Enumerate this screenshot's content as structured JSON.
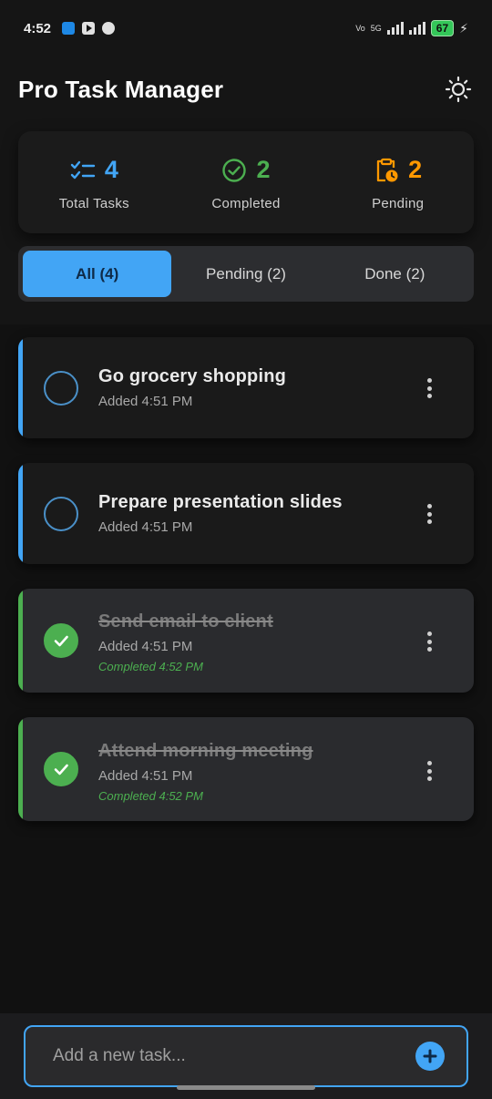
{
  "status_bar": {
    "time": "4:52",
    "network_label_1": "Vo",
    "network_label_2": "5G",
    "battery": "67",
    "icons": [
      "app-icon",
      "youtube-icon",
      "call-icon",
      "signal-icon",
      "battery-icon",
      "charging-icon"
    ]
  },
  "header": {
    "title": "Pro Task Manager",
    "theme_icon": "sun-icon"
  },
  "stats": [
    {
      "value": "4",
      "label": "Total Tasks",
      "icon": "checklist-icon",
      "color": "#42a5f5"
    },
    {
      "value": "2",
      "label": "Completed",
      "icon": "check-circle-icon",
      "color": "#4caf50"
    },
    {
      "value": "2",
      "label": "Pending",
      "icon": "clipboard-clock-icon",
      "color": "#ff9800"
    }
  ],
  "tabs": [
    {
      "label": "All (4)",
      "active": true
    },
    {
      "label": "Pending (2)",
      "active": false
    },
    {
      "label": "Done (2)",
      "active": false
    }
  ],
  "tasks": [
    {
      "title": "Go grocery shopping",
      "added": "Added 4:51 PM",
      "completed": "",
      "done": false
    },
    {
      "title": "Prepare presentation slides",
      "added": "Added 4:51 PM",
      "completed": "",
      "done": false
    },
    {
      "title": "Send email to client",
      "added": "Added 4:51 PM",
      "completed": "Completed 4:52 PM",
      "done": true
    },
    {
      "title": "Attend morning meeting",
      "added": "Added 4:51 PM",
      "completed": "Completed 4:52 PM",
      "done": true
    }
  ],
  "add_task": {
    "placeholder": "Add a new task...",
    "value": ""
  },
  "colors": {
    "accent": "#42a5f5",
    "success": "#4caf50",
    "warning": "#ff9800",
    "background": "#151515"
  }
}
